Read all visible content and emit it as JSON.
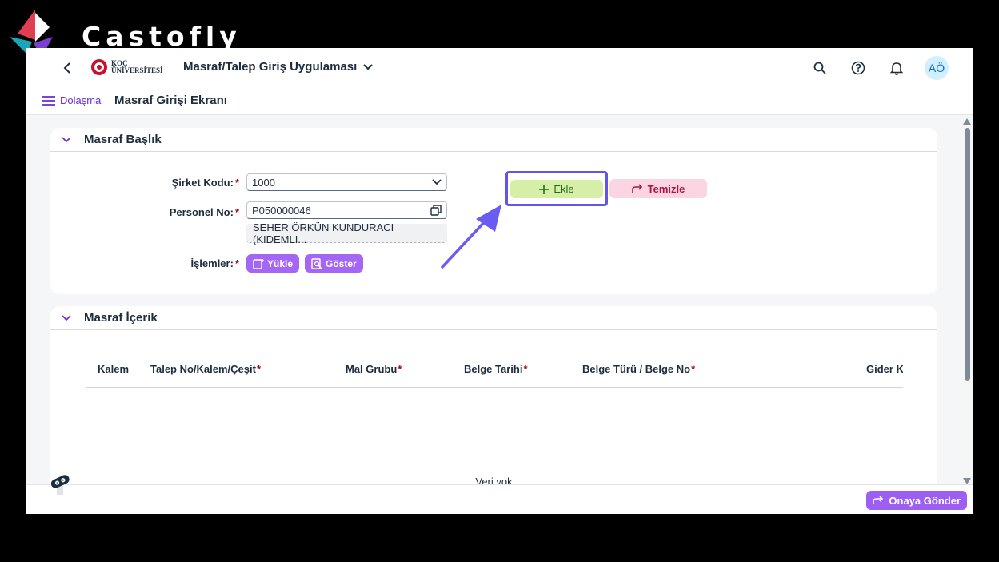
{
  "watermark": {
    "brand": "Castofly"
  },
  "shell": {
    "logo_line1": "KOÇ",
    "logo_line2": "ÜNİVERSİTESİ",
    "app_title": "Masraf/Talep Giriş Uygulaması",
    "avatar_initials": "AÖ"
  },
  "subheader": {
    "nav_label": "Dolaşma",
    "page_title": "Masraf Girişi Ekranı"
  },
  "header_panel": {
    "title": "Masraf Başlık",
    "company_label": "Şirket Kodu:",
    "company_value": "1000",
    "personnel_label": "Personel No:",
    "personnel_value": "P050000046",
    "personnel_name": "SEHER ÖRKÜN KUNDURACI (KIDEMLI...",
    "operations_label": "İşlemler:",
    "load_label": "Yükle",
    "show_label": "Göster",
    "add_label": "Ekle",
    "clear_label": "Temizle",
    "required_mark": "*"
  },
  "content_panel": {
    "title": "Masraf İçerik",
    "columns": [
      "Kalem",
      "Talep No/Kalem/Çeşit",
      "Mal Grubu",
      "Belge Tarihi",
      "Belge Türü / Belge No",
      "Gider Ka"
    ],
    "empty_text": "Veri yok"
  },
  "footer": {
    "submit_label": "Onaya Gönder"
  },
  "colors": {
    "accent_purple": "#a466f5",
    "add_green": "#d7eea7",
    "clear_pink": "#fcd5e2",
    "highlight_frame": "#6356e6",
    "arrow": "#6b5cf0"
  }
}
